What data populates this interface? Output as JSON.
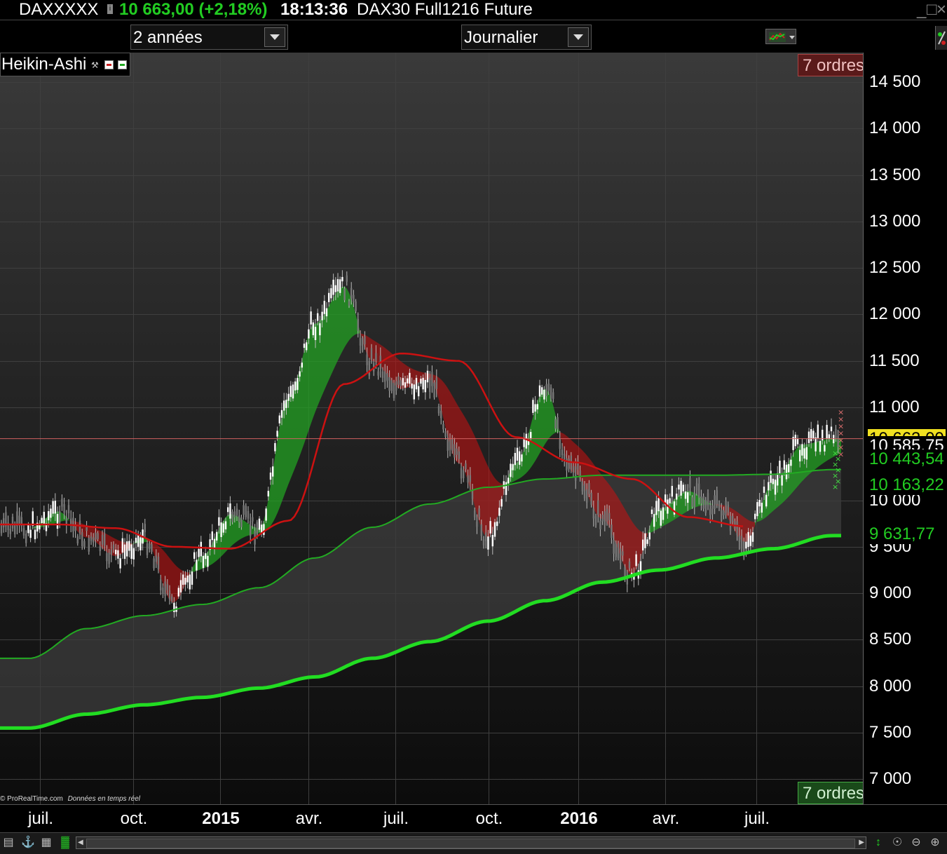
{
  "header": {
    "symbol": "DAXXXXX",
    "info_icon": "info-icon",
    "price_change": "10 663,00 (+2,18%)",
    "time": "18:13:36",
    "instrument": "DAX30 Full1216 Future",
    "window_controls": [
      "_",
      "□",
      "×"
    ]
  },
  "toolbar": {
    "period": "2 années",
    "interval": "Journalier",
    "indicator_menu_icon": "add-indicator-icon",
    "side_icon": "drawing-tools-icon"
  },
  "chart": {
    "indicator_label": "Heikin-Ashi",
    "orders_top": "7 ordres",
    "orders_bottom": "7 ordres",
    "copyright": "© ProRealTime.com",
    "realtime": "Données en temps réel",
    "colors": {
      "bull": "#22bb22",
      "bear": "#cc1111",
      "long_ma": "#22dd22",
      "mid_ma": "#22aa22",
      "short_ma": "#cc1111"
    }
  },
  "y_axis": {
    "ticks": [
      "14 500",
      "14 000",
      "13 500",
      "13 000",
      "12 500",
      "12 000",
      "11 500",
      "11 000",
      "10 000",
      "9 500",
      "9 000",
      "8 500",
      "8 000",
      "7 500",
      "7 000"
    ],
    "tick_values": [
      14500,
      14000,
      13500,
      13000,
      12500,
      12000,
      11500,
      11000,
      10000,
      9500,
      9000,
      8500,
      8000,
      7500,
      7000
    ],
    "price_tags": [
      {
        "text": "10 663,50",
        "value": 10663.5,
        "bg": "#000000",
        "color": "#e08080"
      },
      {
        "text": "10 663,00",
        "value": 10663,
        "bg": "#f0e020",
        "color": "#000000"
      },
      {
        "text": "10 585,75",
        "value": 10585.75,
        "bg": "#000000",
        "color": "#ffffff"
      },
      {
        "text": "10 443,54",
        "value": 10443.54,
        "bg": "#000000",
        "color": "#22cc22"
      },
      {
        "text": "10 163,22",
        "value": 10163.22,
        "bg": "#000000",
        "color": "#22cc22"
      },
      {
        "text": "9 631,77",
        "value": 9631.77,
        "bg": "#000000",
        "color": "#22cc22"
      }
    ]
  },
  "x_axis": {
    "labels": [
      {
        "text": "juil.",
        "bold": false
      },
      {
        "text": "oct.",
        "bold": false
      },
      {
        "text": "2015",
        "bold": true
      },
      {
        "text": "avr.",
        "bold": false
      },
      {
        "text": "juil.",
        "bold": false
      },
      {
        "text": "oct.",
        "bold": false
      },
      {
        "text": "2016",
        "bold": true
      },
      {
        "text": "avr.",
        "bold": false
      },
      {
        "text": "juil.",
        "bold": false
      }
    ]
  },
  "chart_data": {
    "type": "candlestick",
    "title": "",
    "ylim": [
      6900,
      14700
    ],
    "grid": true,
    "last_price": 10663,
    "series": [
      {
        "name": "",
        "style": "line-thick",
        "color": "#22dd22",
        "x": [
          "2014-05",
          "2014-07",
          "2014-09",
          "2014-11",
          "2015-01",
          "2015-03",
          "2015-05",
          "2015-07",
          "2015-09",
          "2015-11",
          "2016-01",
          "2016-03",
          "2016-05",
          "2016-07",
          "2016-09"
        ],
        "values": [
          7550,
          7700,
          7800,
          7880,
          7980,
          8100,
          8300,
          8480,
          8700,
          8920,
          9120,
          9250,
          9380,
          9480,
          9620
        ]
      },
      {
        "name": "",
        "style": "line",
        "color": "#22aa22",
        "x": [
          "2014-05",
          "2014-07",
          "2014-09",
          "2014-11",
          "2015-01",
          "2015-03",
          "2015-05",
          "2015-07",
          "2015-09",
          "2015-11",
          "2016-01",
          "2016-03",
          "2016-05",
          "2016-07",
          "2016-09"
        ],
        "values": [
          8300,
          8620,
          8760,
          8880,
          9060,
          9380,
          9710,
          9960,
          10140,
          10230,
          10270,
          10270,
          10270,
          10280,
          10330
        ]
      },
      {
        "name": "",
        "style": "line",
        "color": "#cc1111",
        "x": [
          "2014-06",
          "2014-08",
          "2014-10",
          "2014-12",
          "2015-02",
          "2015-04",
          "2015-06",
          "2015-08",
          "2015-10",
          "2015-12",
          "2016-02",
          "2016-04",
          "2016-06"
        ],
        "values": [
          9740,
          9700,
          9500,
          9480,
          9780,
          11250,
          11580,
          11500,
          10680,
          10410,
          10230,
          9820,
          9720
        ]
      },
      {
        "name": "",
        "style": "candles-approx",
        "color": "#ffffff",
        "x": [
          "2014-05",
          "2014-06",
          "2014-07",
          "2014-08",
          "2014-09",
          "2014-10",
          "2014-11",
          "2014-12",
          "2015-01",
          "2015-02",
          "2015-03",
          "2015-04",
          "2015-05",
          "2015-06",
          "2015-07",
          "2015-08",
          "2015-09",
          "2015-10",
          "2015-11",
          "2015-12",
          "2016-01",
          "2016-02",
          "2016-03",
          "2016-04",
          "2016-05",
          "2016-06",
          "2016-07",
          "2016-08",
          "2016-09"
        ],
        "values": [
          9700,
          9880,
          9600,
          9400,
          9600,
          8900,
          9400,
          9850,
          9700,
          11100,
          11900,
          12300,
          11500,
          11200,
          11300,
          10400,
          9600,
          10400,
          11200,
          10300,
          9800,
          9200,
          9900,
          10100,
          9950,
          9550,
          10200,
          10600,
          10663
        ]
      }
    ]
  }
}
